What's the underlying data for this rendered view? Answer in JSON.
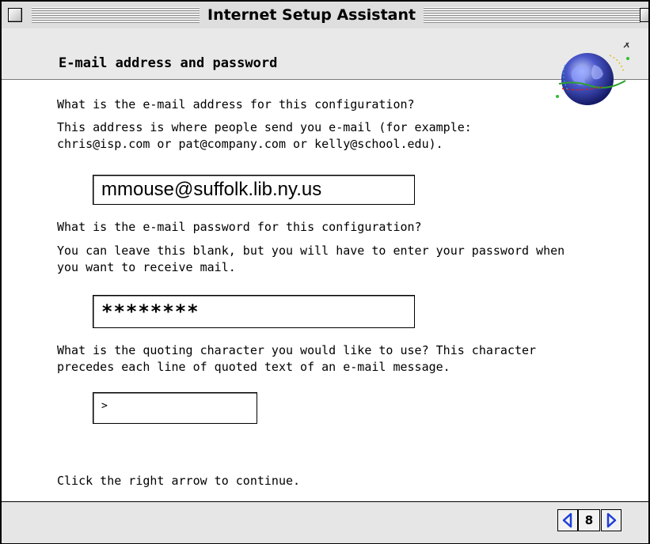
{
  "window": {
    "title": "Internet Setup Assistant"
  },
  "section": {
    "heading": "E-mail address and password"
  },
  "questions": {
    "email_q": "What is the e-mail address for this configuration?",
    "email_help_1": "This address is where people send you e-mail (for example:",
    "email_help_2": "chris@isp.com or pat@company.com or kelly@school.edu).",
    "password_q": "What is the e-mail password for this configuration?",
    "password_help_1": "You can leave this blank, but you will have to enter your password when",
    "password_help_2": "you want to receive mail.",
    "quote_q_1": "What is the quoting character you would like to use?  This character",
    "quote_q_2": "precedes each line of quoted text of an e-mail message.",
    "continue_hint": "Click the right arrow to continue."
  },
  "fields": {
    "email_value": "mmouse@suffolk.lib.ny.us",
    "password_value": "********",
    "quote_value": ">"
  },
  "footer": {
    "page_number": "8"
  },
  "icons": {
    "globe": "globe-icon",
    "prev": "left-arrow-icon",
    "next": "right-arrow-icon"
  },
  "colors": {
    "arrow_blue": "#1f3fd6"
  }
}
